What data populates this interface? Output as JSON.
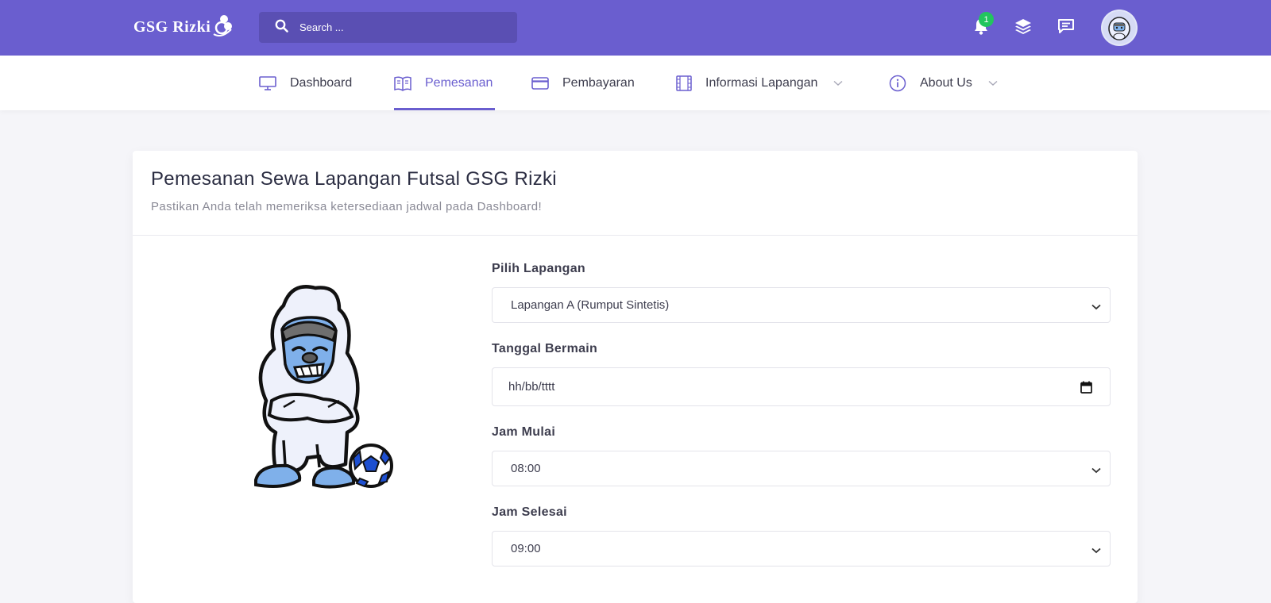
{
  "brand": {
    "logo_text": "GSG Rizki"
  },
  "search": {
    "placeholder": "Search ..."
  },
  "notifications": {
    "count": "1"
  },
  "nav": {
    "items": [
      {
        "label": "Dashboard",
        "icon": "monitor-icon"
      },
      {
        "label": "Pemesanan",
        "icon": "book-icon",
        "active": true
      },
      {
        "label": "Pembayaran",
        "icon": "credit-card-icon"
      },
      {
        "label": "Informasi Lapangan",
        "icon": "film-icon",
        "dropdown": true
      },
      {
        "label": "About Us",
        "icon": "info-icon",
        "dropdown": true
      }
    ]
  },
  "page": {
    "title": "Pemesanan Sewa Lapangan Futsal GSG Rizki",
    "subtitle": "Pastikan Anda telah memeriksa ketersediaan jadwal pada Dashboard!"
  },
  "form": {
    "lapangan": {
      "label": "Pilih Lapangan",
      "value": "Lapangan A (Rumput Sintetis)"
    },
    "tanggal": {
      "label": "Tanggal Bermain",
      "placeholder": "hh/bb/tttt"
    },
    "jam_mulai": {
      "label": "Jam Mulai",
      "value": "08:00"
    },
    "jam_selesai": {
      "label": "Jam Selesai",
      "value": "09:00"
    }
  },
  "colors": {
    "primary": "#6a5ecf",
    "primary_dark": "#5a4fb3",
    "badge": "#22c55e",
    "background": "#f5f5f9"
  },
  "icons": [
    "search-icon",
    "bell-icon",
    "layers-icon",
    "message-icon",
    "chevron-down-icon",
    "calendar-icon"
  ]
}
